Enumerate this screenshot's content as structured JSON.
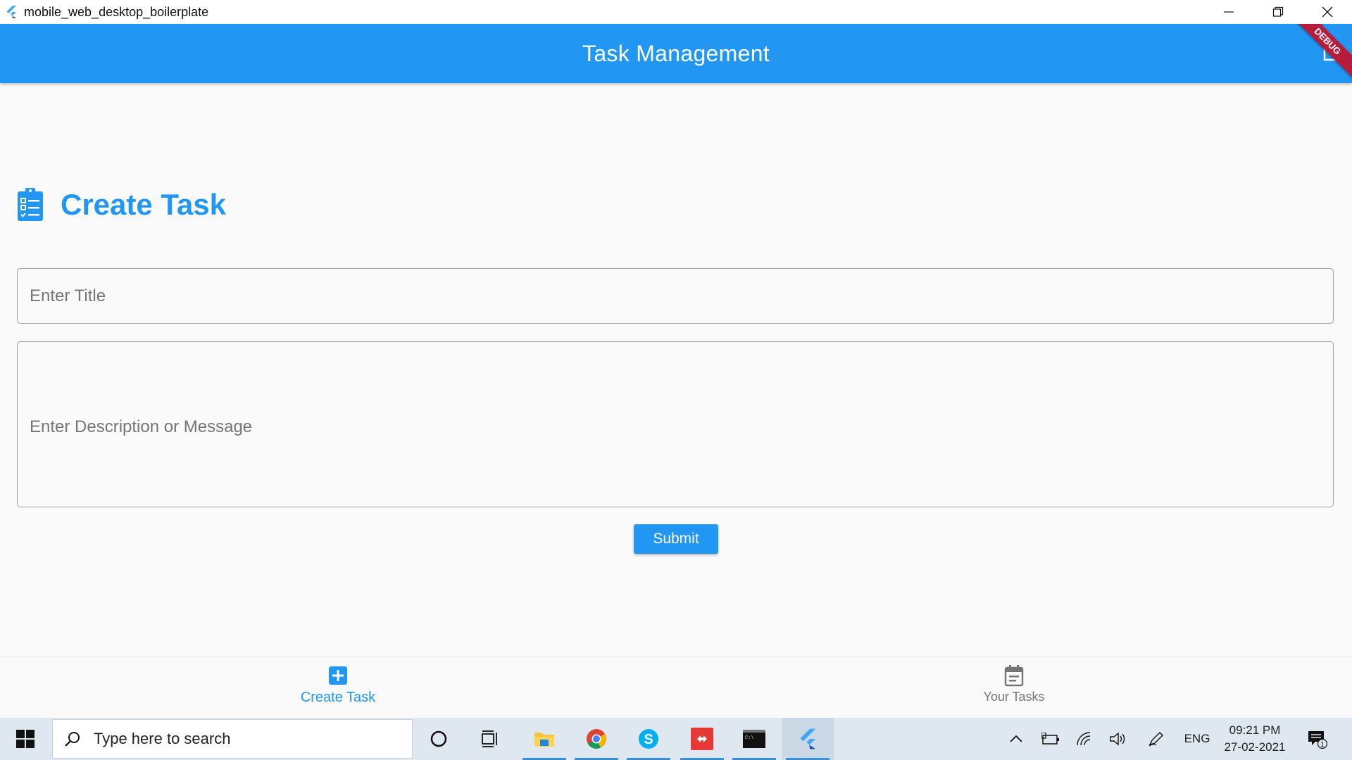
{
  "window": {
    "title": "mobile_web_desktop_boilerplate",
    "controls": [
      "minimize",
      "restore",
      "close"
    ]
  },
  "appbar": {
    "title": "Task Management",
    "debug_banner": "DEBUG",
    "color": "#2196f3"
  },
  "form": {
    "heading": "Create Task",
    "heading_icon": "clipboard-list-icon",
    "title_placeholder": "Enter Title",
    "description_placeholder": "Enter Description or Message",
    "submit_label": "Submit"
  },
  "bottom_nav": {
    "items": [
      {
        "label": "Create Task",
        "icon": "add-box-icon",
        "selected": true
      },
      {
        "label": "Your Tasks",
        "icon": "calendar-icon",
        "selected": false
      }
    ]
  },
  "taskbar": {
    "search_placeholder": "Type here to search",
    "apps": [
      "cortana-icon",
      "task-view-icon",
      "file-explorer-icon",
      "chrome-icon",
      "skype-icon",
      "git-app-icon",
      "terminal-icon",
      "flutter-icon"
    ],
    "tray": {
      "language": "ENG",
      "time": "09:21 PM",
      "date": "27-02-2021",
      "notification_count": "1"
    }
  }
}
